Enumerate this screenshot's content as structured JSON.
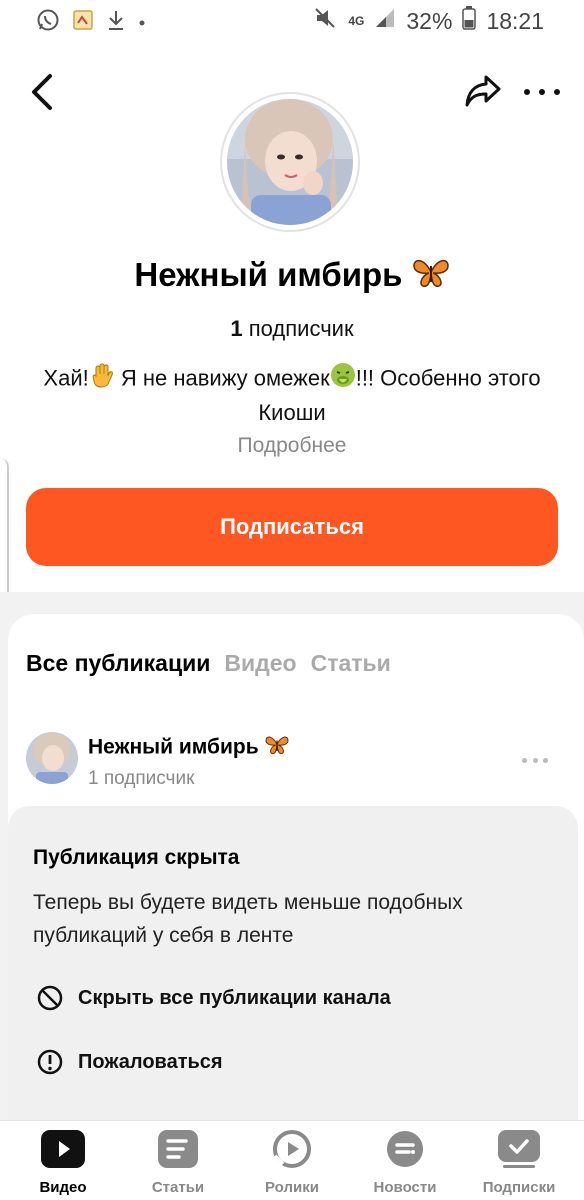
{
  "status_bar": {
    "battery": "32%",
    "time": "18:21",
    "network": "4G",
    "icons": [
      "whatsapp-icon",
      "notification-icon",
      "download-icon",
      "dot-icon",
      "mute-icon",
      "signal-icon",
      "battery-icon"
    ]
  },
  "nav": {
    "back_icon": "chevron-left-icon",
    "share_icon": "share-icon",
    "more_icon": "more-horizontal-icon"
  },
  "profile": {
    "name": "Нежный имбирь",
    "name_emoji": "butterfly",
    "subs_count": "1",
    "subs_label": "подписчик",
    "description_part1": "Хай!",
    "description_part2": " Я не навижу омежек",
    "description_part3": "!!! Особенно этого Киоши",
    "more_label": "Подробнее",
    "subscribe_label": "Подписаться"
  },
  "tabs": [
    {
      "label": "Все публикации",
      "active": true
    },
    {
      "label": "Видео",
      "active": false
    },
    {
      "label": "Статьи",
      "active": false
    }
  ],
  "post": {
    "author_name": "Нежный имбирь",
    "author_subs": "1 подписчик"
  },
  "hidden": {
    "title": "Публикация скрыта",
    "text": "Теперь вы будете видеть меньше подобных публикаций у себя в ленте",
    "hide_all_label": "Скрыть все публикации канала",
    "report_label": "Пожаловаться"
  },
  "bottom_nav": [
    {
      "label": "Видео",
      "icon": "play-icon",
      "active": true
    },
    {
      "label": "Статьи",
      "icon": "article-icon",
      "active": false
    },
    {
      "label": "Ролики",
      "icon": "clips-icon",
      "active": false
    },
    {
      "label": "Новости",
      "icon": "news-icon",
      "active": false
    },
    {
      "label": "Подписки",
      "icon": "subscriptions-icon",
      "active": false
    }
  ],
  "colors": {
    "accent": "#ff5722",
    "muted_text": "#888888",
    "inactive_tab": "#aaaaaa",
    "panel_bg": "#f0f0f0"
  }
}
